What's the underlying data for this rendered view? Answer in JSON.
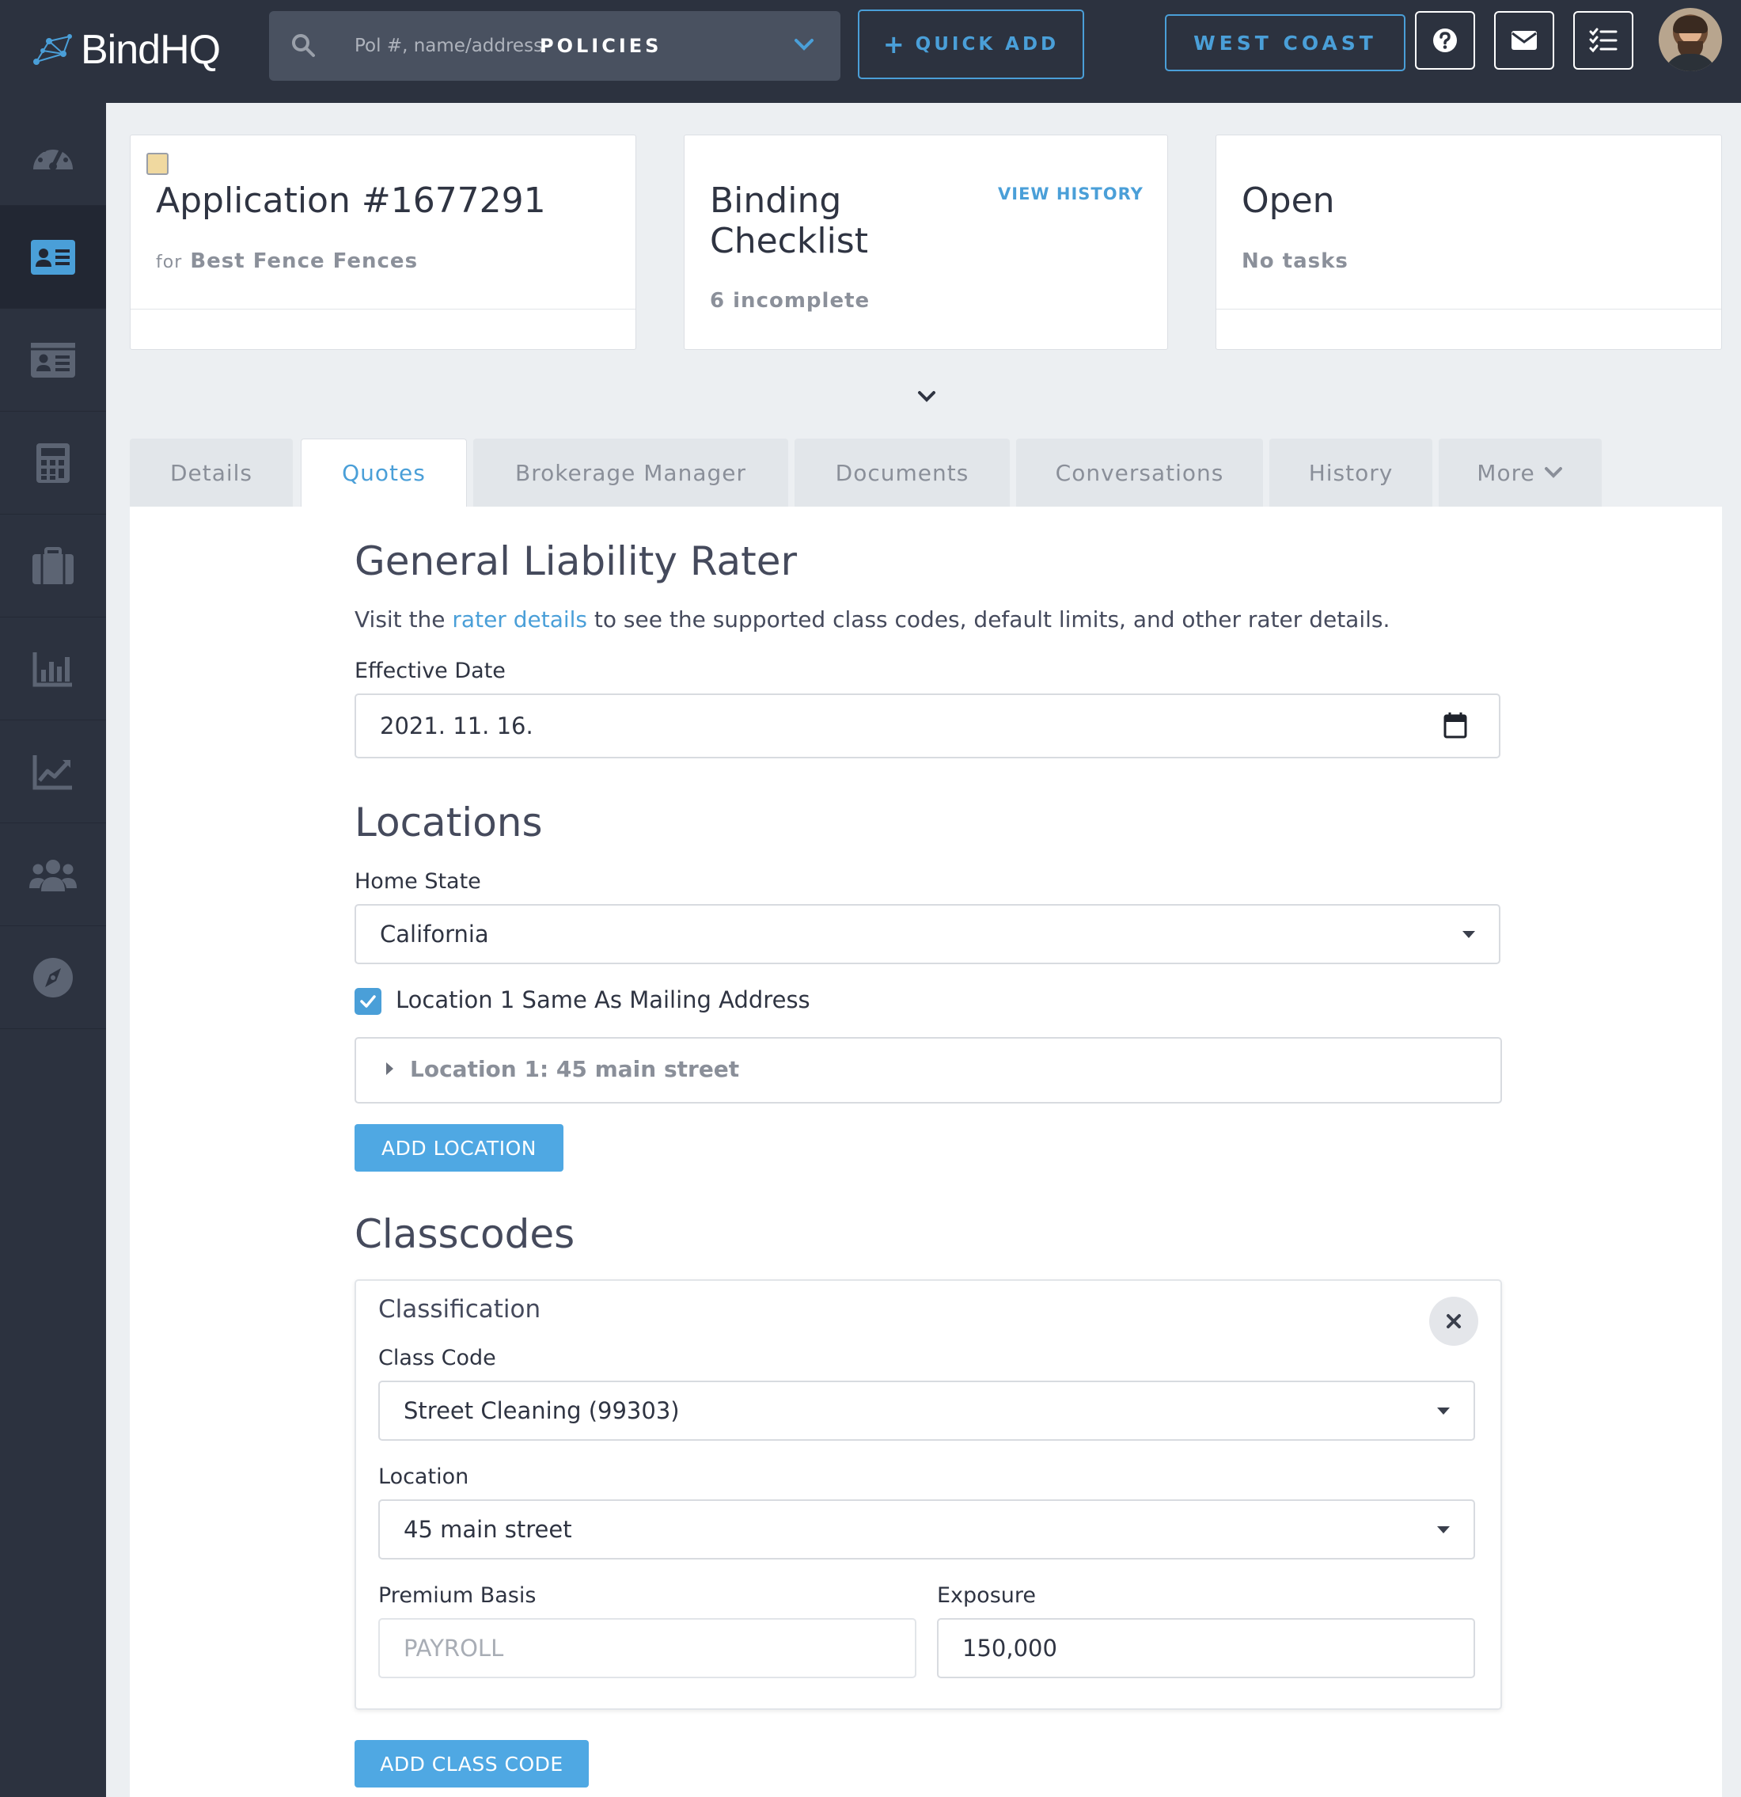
{
  "topbar": {
    "logo_text": "BindHQ",
    "search_placeholder": "Pol #, name/address",
    "search_scope": "POLICIES",
    "quick_add": "QUICK ADD",
    "region": "WEST COAST",
    "icons": [
      "help-icon",
      "mail-icon",
      "tasks-list-icon"
    ]
  },
  "sidebar": {
    "items": [
      "dashboard-icon",
      "applications-icon",
      "policies-icon",
      "calculator-icon",
      "briefcase-icon",
      "reports-icon",
      "analytics-icon",
      "users-icon",
      "compass-icon"
    ],
    "active_index": 1
  },
  "cards": {
    "application": {
      "title": "Application #1677291",
      "prefix": "for",
      "insured": "Best Fence Fences"
    },
    "checklist": {
      "title_line1": "Binding",
      "title_line2": "Checklist",
      "status": "6 incomplete",
      "link": "VIEW HISTORY"
    },
    "status": {
      "title": "Open",
      "sub": "No tasks"
    }
  },
  "tabs": [
    {
      "label": "Details"
    },
    {
      "label": "Quotes",
      "active": true
    },
    {
      "label": "Brokerage Manager"
    },
    {
      "label": "Documents"
    },
    {
      "label": "Conversations"
    },
    {
      "label": "History"
    },
    {
      "label": "More"
    }
  ],
  "form": {
    "title": "General Liability Rater",
    "intro_before": "Visit the ",
    "intro_link": "rater details",
    "intro_after": " to see the supported class codes, default limits, and other rater details.",
    "effective_date_label": "Effective Date",
    "effective_date_value": "2021. 11. 16.",
    "locations_title": "Locations",
    "home_state_label": "Home State",
    "home_state_value": "California",
    "same_as_mailing_label": "Location 1 Same As Mailing Address",
    "same_as_mailing_checked": true,
    "location_1_label": "Location 1: 45 main street",
    "add_location_label": "ADD LOCATION",
    "classcodes_title": "Classcodes",
    "classification_title": "Classification",
    "class_code_label": "Class Code",
    "class_code_value": "Street Cleaning (99303)",
    "location_label": "Location",
    "location_value": "45 main street",
    "premium_basis_label": "Premium Basis",
    "premium_basis_value": "PAYROLL",
    "exposure_label": "Exposure",
    "exposure_value": "150,000",
    "add_class_code_label": "ADD CLASS CODE"
  },
  "colors": {
    "accent": "#4a9fd8",
    "topbar": "#2c323f",
    "button": "#4fa8e3"
  }
}
